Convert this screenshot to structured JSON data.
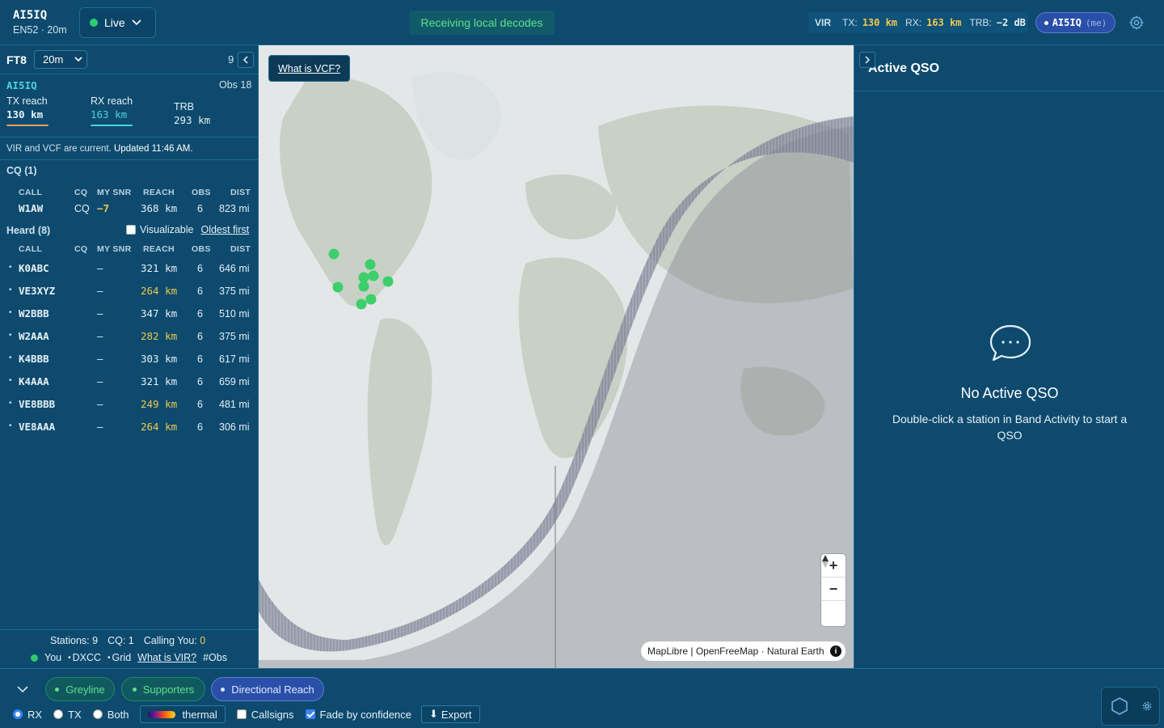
{
  "station": {
    "call": "AI5IQ",
    "sub": "EN52 · 20m"
  },
  "live": {
    "label": "Live"
  },
  "banner": {
    "receiving": "Receiving local decodes"
  },
  "vir": {
    "label": "VIR",
    "tx_label": "TX:",
    "tx_value": "130 km",
    "rx_label": "RX:",
    "rx_value": "163 km",
    "trb_label": "TRB:",
    "trb_value": "−2 dB"
  },
  "me_pill": {
    "call": "AI5IQ",
    "suffix": "(me)"
  },
  "left": {
    "mode": "FT8",
    "band": "20m",
    "count": "9",
    "reach": {
      "call": "AI5IQ",
      "obs": "Obs 18",
      "tx_label": "TX reach",
      "tx_value": "130 km",
      "rx_label": "RX reach",
      "rx_value": "163 km",
      "trb_label": "TRB",
      "trb_value": "293 km"
    },
    "status_prefix": "VIR and VCF are current.",
    "status_updated": "Updated 11:46 AM.",
    "cq_title": "CQ (1)",
    "heard_title": "Heard (8)",
    "visualizable": "Visualizable",
    "oldest_first": "Oldest first",
    "columns": {
      "call": "CALL",
      "cq": "CQ",
      "snr": "MY SNR",
      "reach": "REACH",
      "obs": "OBS",
      "dist": "DIST"
    },
    "cq_rows": [
      {
        "call": "W1AW",
        "cq": "CQ",
        "snr": "−7",
        "reach": "368 km",
        "obs": "6",
        "dist": "823 mi"
      }
    ],
    "heard_rows": [
      {
        "call": "K0ABC",
        "cq": "",
        "snr": "—",
        "reach": "321 km",
        "obs": "6",
        "dist": "646 mi",
        "hl": false
      },
      {
        "call": "VE3XYZ",
        "cq": "",
        "snr": "—",
        "reach": "264 km",
        "obs": "6",
        "dist": "375 mi",
        "hl": true
      },
      {
        "call": "W2BBB",
        "cq": "",
        "snr": "—",
        "reach": "347 km",
        "obs": "6",
        "dist": "510 mi",
        "hl": false
      },
      {
        "call": "W2AAA",
        "cq": "",
        "snr": "—",
        "reach": "282 km",
        "obs": "6",
        "dist": "375 mi",
        "hl": true
      },
      {
        "call": "K4BBB",
        "cq": "",
        "snr": "—",
        "reach": "303 km",
        "obs": "6",
        "dist": "617 mi",
        "hl": false
      },
      {
        "call": "K4AAA",
        "cq": "",
        "snr": "—",
        "reach": "321 km",
        "obs": "6",
        "dist": "659 mi",
        "hl": false
      },
      {
        "call": "VE8BBB",
        "cq": "",
        "snr": "—",
        "reach": "249 km",
        "obs": "6",
        "dist": "481 mi",
        "hl": true
      },
      {
        "call": "VE8AAA",
        "cq": "",
        "snr": "—",
        "reach": "264 km",
        "obs": "6",
        "dist": "306 mi",
        "hl": true
      }
    ],
    "footer": {
      "stations_label": "Stations:",
      "stations_value": "9",
      "cq_label": "CQ:",
      "cq_value": "1",
      "calling_label": "Calling You:",
      "calling_value": "0",
      "legend_you": "You",
      "legend_dxcc": "DXCC",
      "legend_grid": "Grid",
      "legend_vir": "What is VIR?",
      "legend_obs": "#Obs"
    }
  },
  "map": {
    "vcf_button": "What is VCF?",
    "zoom_in": "+",
    "zoom_out": "−",
    "attribution": "MapLibre | OpenFreeMap · Natural Earth",
    "info": "i"
  },
  "right": {
    "title": "Active QSO",
    "empty_title": "No Active QSO",
    "empty_sub": "Double-click a station in Band Activity to start a QSO"
  },
  "bottom": {
    "greyline": "Greyline",
    "supporters": "Supporters",
    "directional": "Directional Reach",
    "rx": "RX",
    "tx": "TX",
    "both": "Both",
    "thermal": "thermal",
    "callsigns": "Callsigns",
    "fade": "Fade by confidence",
    "export": "Export",
    "export_icon": "⬇"
  },
  "colors": {
    "accent_green": "#2ecc71",
    "accent_yellow": "#f2c94c",
    "accent_cyan": "#4fd1d9",
    "panel": "#0d4a6e"
  },
  "icons": {
    "settings": "gear-icon",
    "chat": "chat-bubble-icon",
    "chevron": "chevron-down-icon"
  }
}
